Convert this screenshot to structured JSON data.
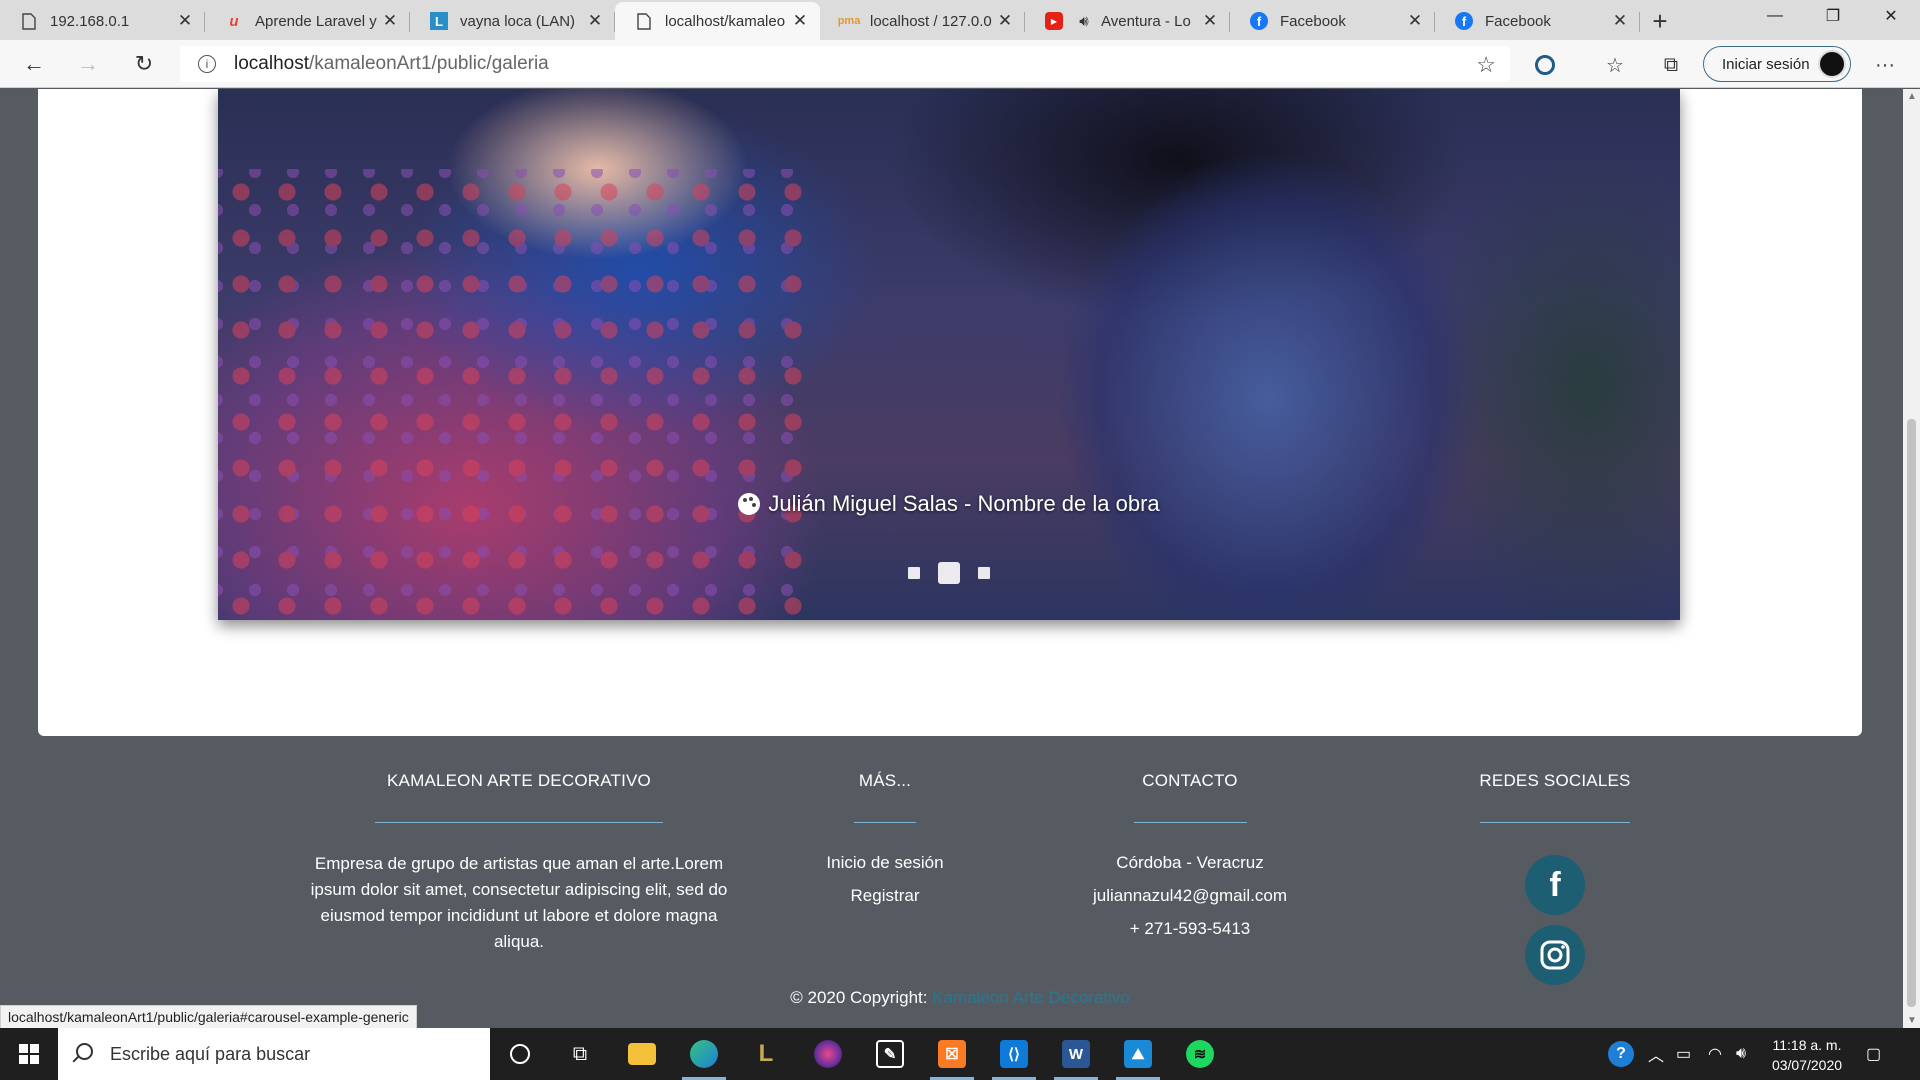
{
  "browser": {
    "tabs": [
      {
        "title": "192.168.0.1",
        "icon": "page-icon",
        "active": false
      },
      {
        "title": "Aprende Laravel y",
        "icon": "laravel-icon",
        "active": false
      },
      {
        "title": "vayna loca (LAN)",
        "icon": "l-app-icon",
        "active": false
      },
      {
        "title": "localhost/kamaleo",
        "icon": "page-icon",
        "active": true
      },
      {
        "title": "localhost / 127.0.0",
        "icon": "phpmyadmin-icon",
        "active": false
      },
      {
        "title": "Aventura - Lo",
        "icon": "youtube-icon",
        "active": false
      },
      {
        "title": "Facebook",
        "icon": "facebook-icon",
        "active": false
      },
      {
        "title": "Facebook",
        "icon": "facebook-icon",
        "active": false
      }
    ],
    "url_host": "localhost",
    "url_path": "/kamaleonArt1/public/galeria",
    "signin_label": "Iniciar sesión",
    "status_url": "localhost/kamaleonArt1/public/galeria#carousel-example-generic"
  },
  "carousel": {
    "caption": "Julián Miguel Salas - Nombre de la obra",
    "slide_count": 3,
    "active_index": 1
  },
  "footer": {
    "about": {
      "heading": "KAMALEON ARTE DECORATIVO",
      "text": "Empresa de grupo de artistas que aman el arte.Lorem ipsum dolor sit amet, consectetur adipiscing elit, sed do eiusmod tempor incididunt ut labore et dolore magna aliqua."
    },
    "more": {
      "heading": "MÁS...",
      "links": [
        "Inicio de sesión",
        "Registrar"
      ]
    },
    "contact": {
      "heading": "CONTACTO",
      "lines": [
        "Córdoba - Veracruz",
        "juliannazul42@gmail.com",
        "+ 271-593-5413"
      ]
    },
    "social": {
      "heading": "REDES SOCIALES",
      "icons": [
        "facebook-icon",
        "instagram-icon"
      ]
    },
    "copyright_prefix": "© 2020 Copyright:",
    "copyright_brand": "Kamaleon Arte Decorativo"
  },
  "taskbar": {
    "search_placeholder": "Escribe aquí para buscar",
    "time": "11:18 a. m.",
    "date": "03/07/2020"
  },
  "colors": {
    "footer_bg": "#565b61",
    "accent_rule": "#7db4d6",
    "social_bg": "#1e5e73",
    "brand_link": "#2c7690"
  }
}
